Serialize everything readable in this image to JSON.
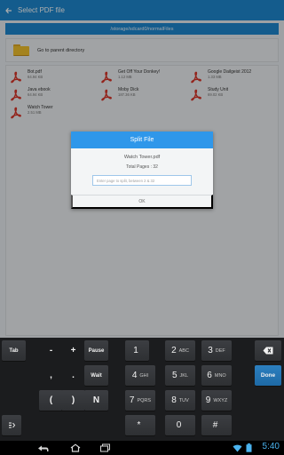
{
  "actionbar": {
    "title": "Select PDF file"
  },
  "path": "/storage/sdcard0/normalFiles",
  "parent_row": {
    "label": "Go to parent directory"
  },
  "files": [
    {
      "name": "Bot.pdf",
      "size": "64.94 KB"
    },
    {
      "name": "Get Off Your Donkey!",
      "size": "1.12 MB"
    },
    {
      "name": "Google Dailgeist 2012",
      "size": "1.33 MB"
    },
    {
      "name": "Java ebook",
      "size": "64.94 KB"
    },
    {
      "name": "Moby Dick",
      "size": "187.36 KB"
    },
    {
      "name": "Study Unit",
      "size": "69.02 KB"
    },
    {
      "name": "Watch Tower",
      "size": "2.51 MB"
    }
  ],
  "dialog": {
    "title": "Split File",
    "file_name": "Watch Tower.pdf",
    "total_pages": "Total Pages : 32",
    "input_placeholder": "Enter page to split, between 2 & 32",
    "ok_label": "OK"
  },
  "keyboard": {
    "tab": "Tab",
    "minus": "-",
    "plus": "+",
    "pause": "Pause",
    "comma": ",",
    "period": ".",
    "wait": "Wait",
    "lparen": "(",
    "rparen": ")",
    "n": "N",
    "done": "Done",
    "digits": [
      {
        "num": "1",
        "letters": ""
      },
      {
        "num": "2",
        "letters": "ABC"
      },
      {
        "num": "3",
        "letters": "DEF"
      },
      {
        "num": "4",
        "letters": "GHI"
      },
      {
        "num": "5",
        "letters": "JKL"
      },
      {
        "num": "6",
        "letters": "MNO"
      },
      {
        "num": "7",
        "letters": "PQRS"
      },
      {
        "num": "8",
        "letters": "TUV"
      },
      {
        "num": "9",
        "letters": "WXYZ"
      },
      {
        "num": "*",
        "letters": ""
      },
      {
        "num": "0",
        "letters": ""
      },
      {
        "num": "#",
        "letters": ""
      }
    ]
  },
  "status": {
    "time": "5:40"
  },
  "colors": {
    "accent": "#1e88d0",
    "pdf_red": "#d9352a",
    "clock": "#4bb4f0"
  },
  "icons": [
    "back-arrow-icon",
    "folder-icon",
    "pdf-icon",
    "backspace-icon",
    "emoji-settings-icon",
    "nav-back-icon",
    "nav-home-icon",
    "nav-recents-icon",
    "wifi-icon",
    "battery-icon"
  ]
}
